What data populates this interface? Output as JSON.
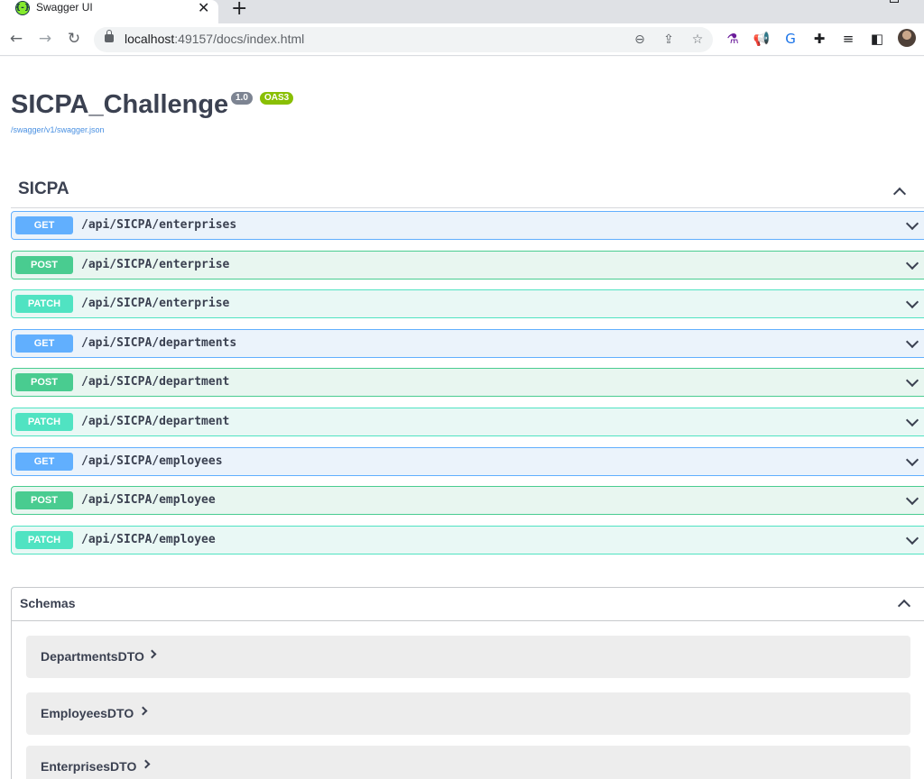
{
  "browser": {
    "tab_title": "Swagger UI",
    "tab_favicon_glyph": "{-}",
    "new_tab_glyph": "+",
    "close_glyph": "✕",
    "url_host": "localhost",
    "url_path": ":49157/docs/index.html"
  },
  "api": {
    "title": "SICPA_Challenge",
    "version": "1.0",
    "oas": "OAS3",
    "spec_url": "/swagger/v1/swagger.json"
  },
  "tag": {
    "name": "SICPA"
  },
  "operations": [
    {
      "method": "GET",
      "path": "/api/SICPA/enterprises"
    },
    {
      "method": "POST",
      "path": "/api/SICPA/enterprise"
    },
    {
      "method": "PATCH",
      "path": "/api/SICPA/enterprise"
    },
    {
      "method": "GET",
      "path": "/api/SICPA/departments"
    },
    {
      "method": "POST",
      "path": "/api/SICPA/department"
    },
    {
      "method": "PATCH",
      "path": "/api/SICPA/department"
    },
    {
      "method": "GET",
      "path": "/api/SICPA/employees"
    },
    {
      "method": "POST",
      "path": "/api/SICPA/employee"
    },
    {
      "method": "PATCH",
      "path": "/api/SICPA/employee"
    }
  ],
  "schemas": {
    "title": "Schemas",
    "models": [
      "DepartmentsDTO",
      "EmployeesDTO",
      "EnterprisesDTO"
    ]
  },
  "colors": {
    "get": "#61affe",
    "post": "#49cc90",
    "patch": "#50e3c2",
    "text": "#3b4151"
  }
}
